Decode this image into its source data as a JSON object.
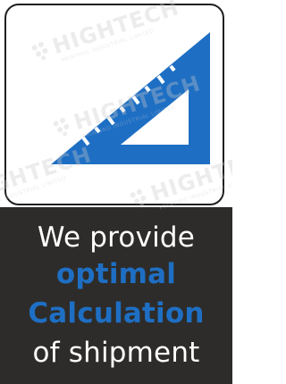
{
  "caption": {
    "line1": "We provide",
    "line2": "optimal",
    "line3": "Calculation",
    "line4": "of shipment"
  },
  "watermark": {
    "brand": "HIGHTECH",
    "subtitle": "PRINTING INDUSTRIAL LIMITED"
  },
  "colors": {
    "accent_blue": "#1e6fc4",
    "caption_background": "#2e2c2a",
    "card_border": "#1f1f1f"
  },
  "icons": {
    "main": "set-square-ruler-icon"
  }
}
